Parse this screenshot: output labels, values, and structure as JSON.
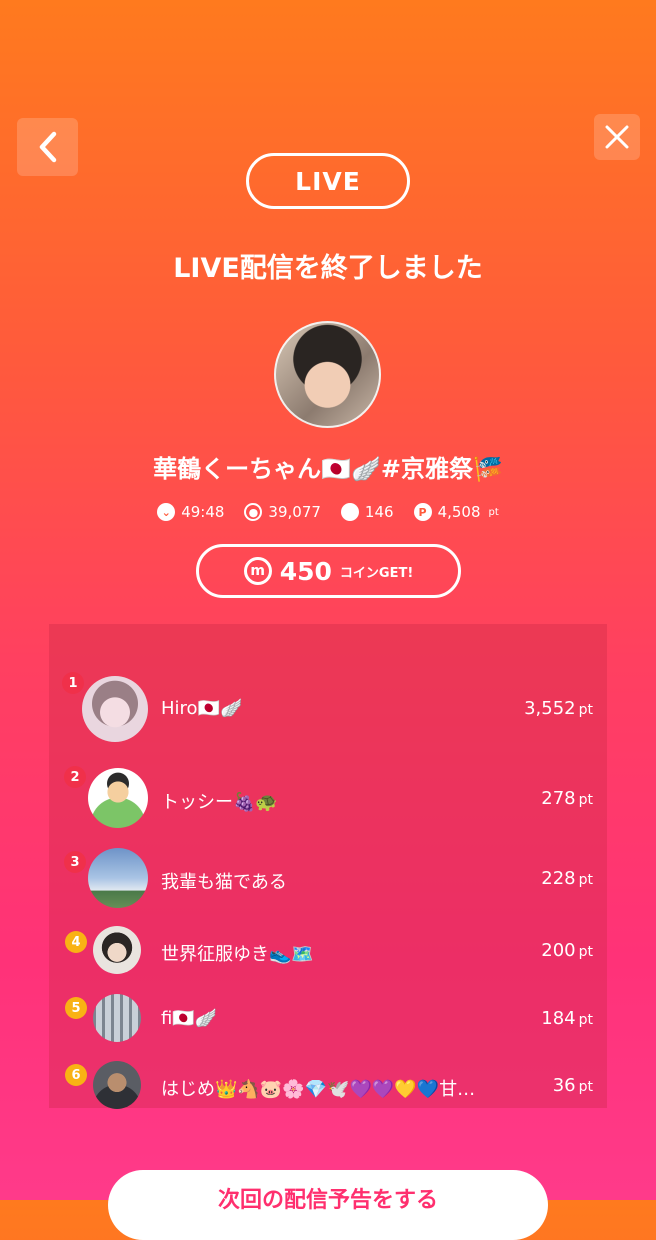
{
  "nav": {
    "back_icon": "chevron-left-icon",
    "close_icon": "close-icon"
  },
  "badge": {
    "label": "LIVE"
  },
  "title": "LIVE配信を終了しました",
  "host": {
    "name": "華鶴くーちゃん🇯🇵🪽#京雅祭🎏"
  },
  "stats": {
    "duration": "49:48",
    "viewers": "39,077",
    "comments": "146",
    "points": "4,508",
    "points_unit": "pt"
  },
  "coins": {
    "icon_letter": "m",
    "amount": "450",
    "label": "コインGET!"
  },
  "ranking": [
    {
      "rank": "1",
      "name": "Hiro🇯🇵🪽",
      "points": "3,552",
      "unit": "pt"
    },
    {
      "rank": "2",
      "name": "トッシー🍇🐢",
      "points": "278",
      "unit": "pt"
    },
    {
      "rank": "3",
      "name": "我輩も猫である",
      "points": "228",
      "unit": "pt"
    },
    {
      "rank": "4",
      "name": "世界征服ゆき👟🗺️",
      "points": "200",
      "unit": "pt"
    },
    {
      "rank": "5",
      "name": "fi🇯🇵🪽",
      "points": "184",
      "unit": "pt"
    },
    {
      "rank": "6",
      "name": "はじめ👑🐴🐷🌸💎🕊️💜💜💛💙甘…",
      "points": "36",
      "unit": "pt"
    }
  ],
  "schedule_button": {
    "label": "次回の配信予告をする"
  },
  "colors": {
    "accent": "#ff2f6e",
    "rank_top": "#f0304a",
    "rank_other": "#f9b214"
  }
}
